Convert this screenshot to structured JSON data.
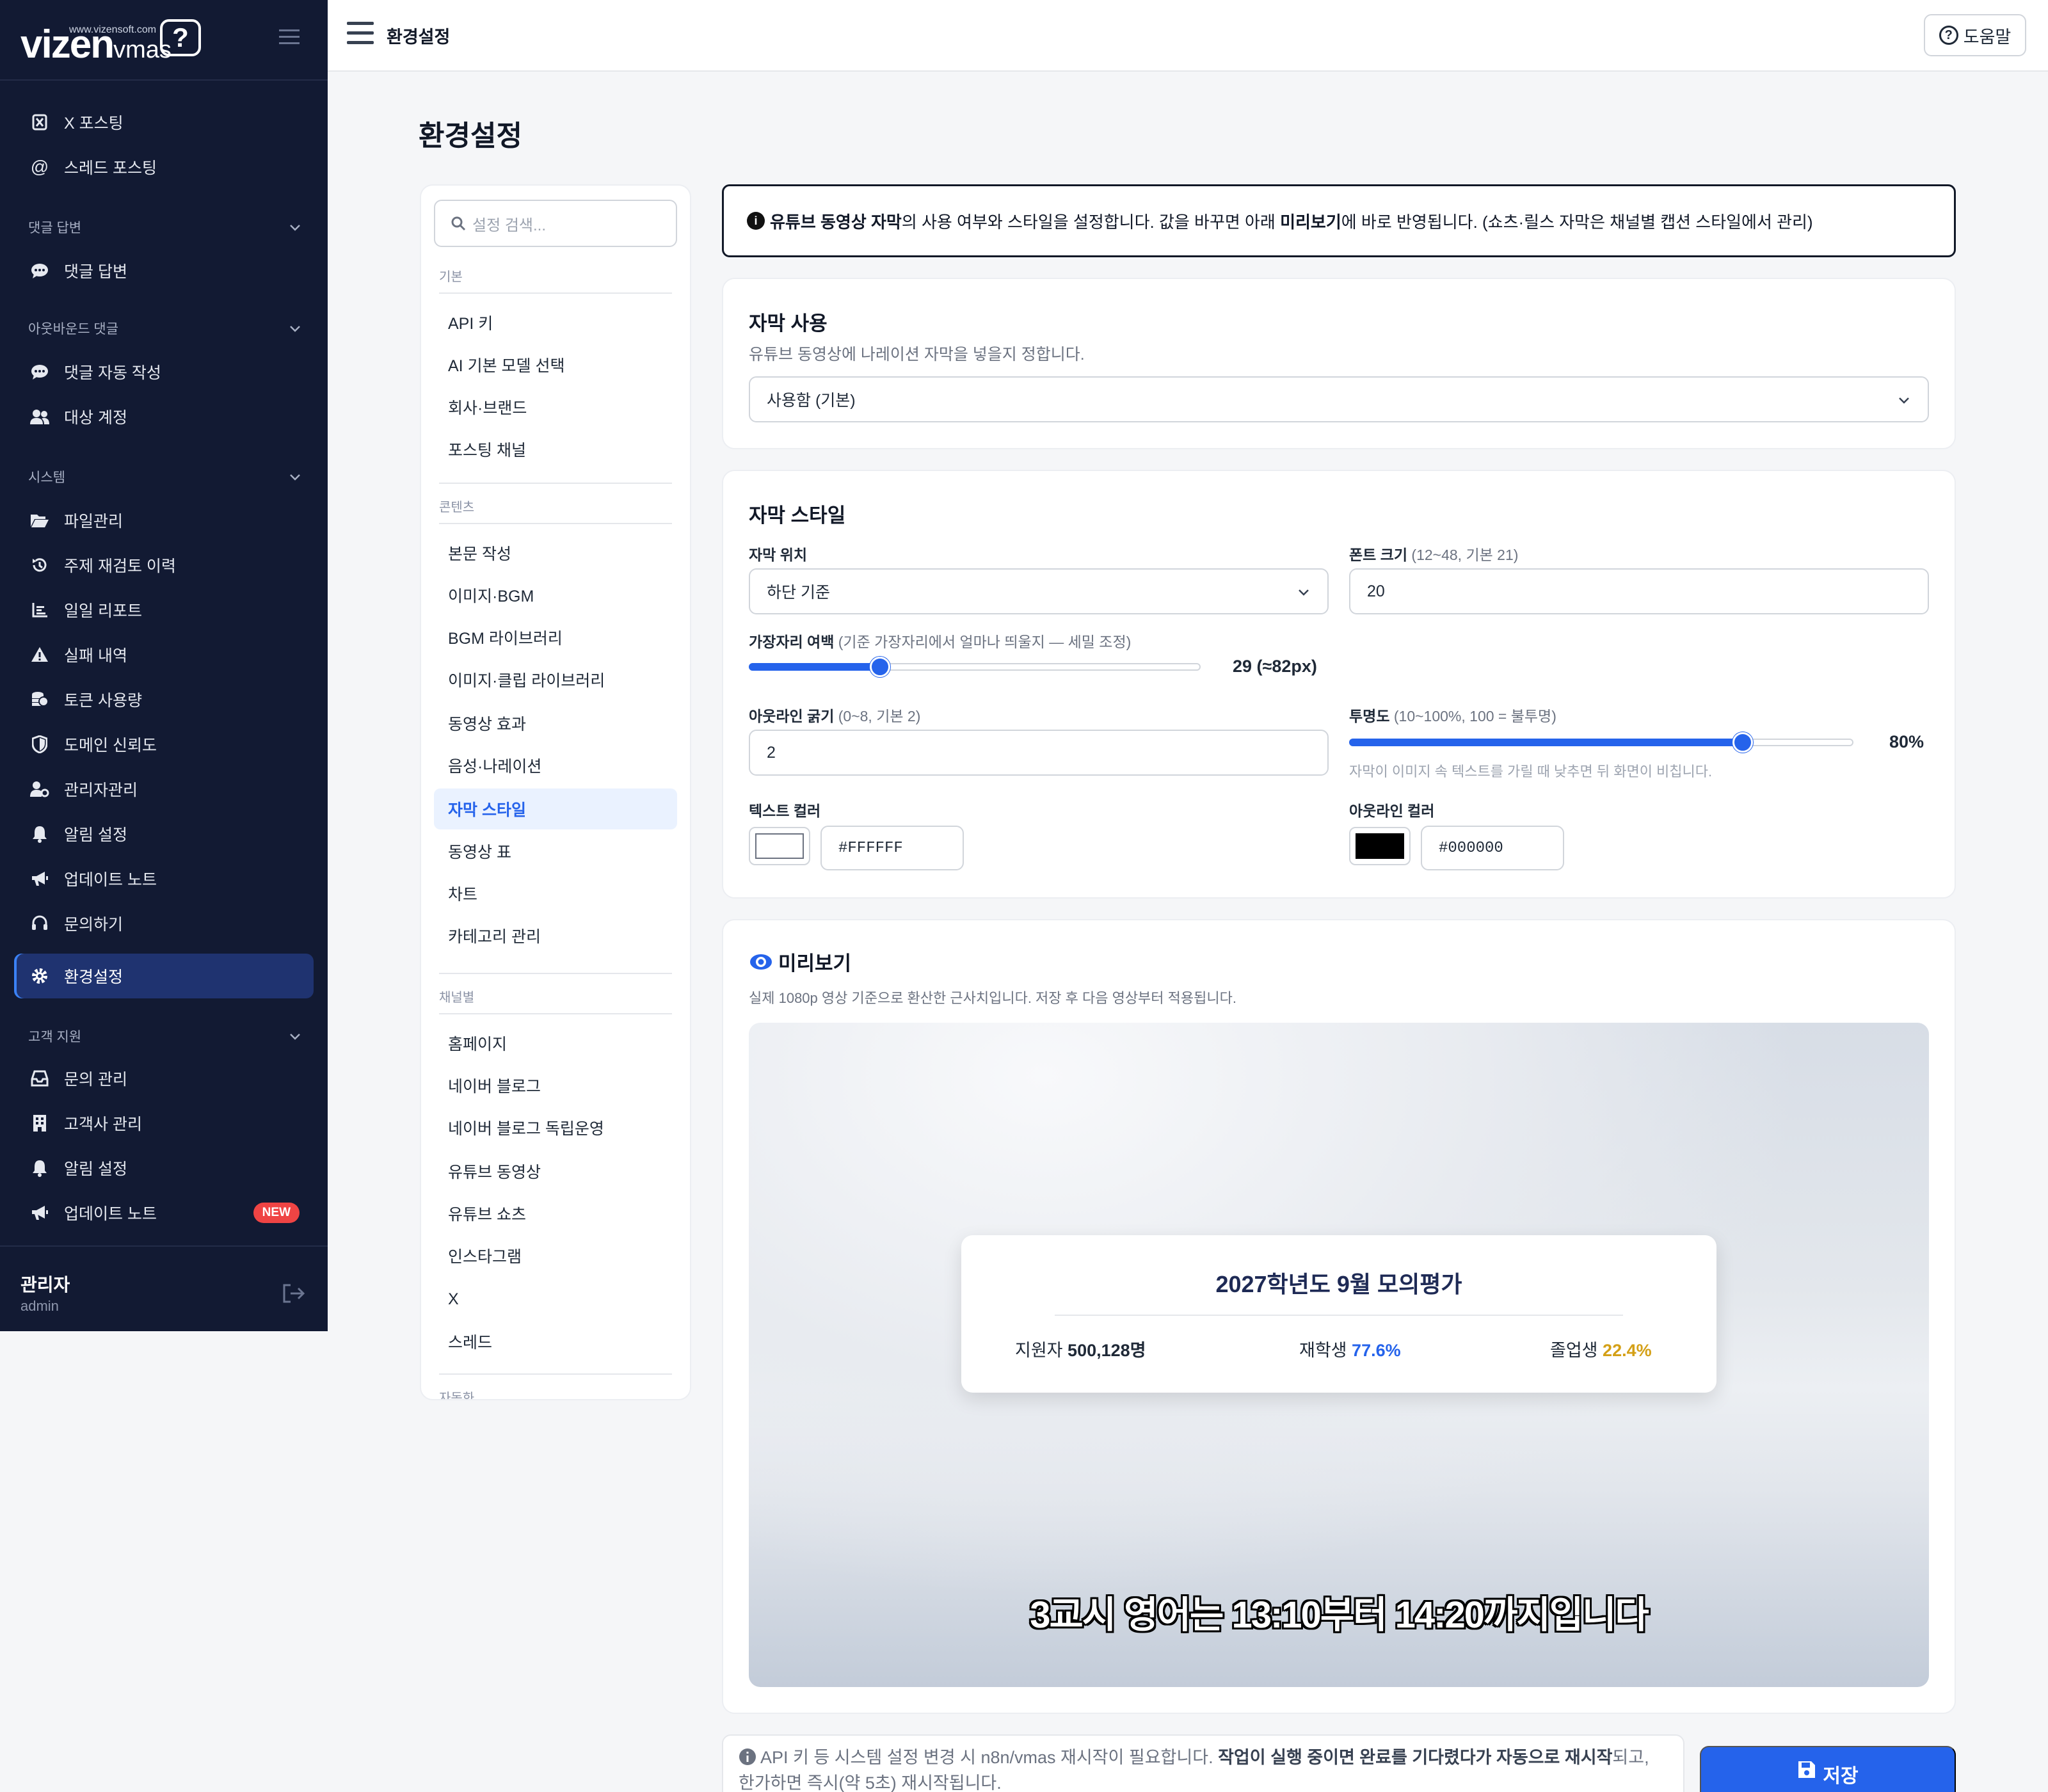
{
  "brand": {
    "logo_main": "vizen",
    "logo_sub": "vmas",
    "url": "www.vizensoft.com",
    "mark": "?"
  },
  "sidebar": {
    "items": [
      {
        "label": "X 포스팅",
        "icon": "x-icon"
      },
      {
        "label": "스레드 포스팅",
        "icon": "at-icon"
      },
      {
        "label": "댓글 답변",
        "icon": "comment-icon"
      },
      {
        "label": "댓글 자동 작성",
        "icon": "comment-icon"
      },
      {
        "label": "대상 계정",
        "icon": "users-icon"
      },
      {
        "label": "파일관리",
        "icon": "folder-icon"
      },
      {
        "label": "주제 재검토 이력",
        "icon": "history-icon"
      },
      {
        "label": "일일 리포트",
        "icon": "chart-icon"
      },
      {
        "label": "실패 내역",
        "icon": "warning-icon"
      },
      {
        "label": "토큰 사용량",
        "icon": "coins-icon"
      },
      {
        "label": "도메인 신뢰도",
        "icon": "shield-icon"
      },
      {
        "label": "관리자관리",
        "icon": "user-gear-icon"
      },
      {
        "label": "알림 설정",
        "icon": "bell-icon"
      },
      {
        "label": "업데이트 노트",
        "icon": "megaphone-icon"
      },
      {
        "label": "문의하기",
        "icon": "headset-icon"
      },
      {
        "label": "환경설정",
        "icon": "gear-icon"
      },
      {
        "label": "문의 관리",
        "icon": "inbox-icon"
      },
      {
        "label": "고객사 관리",
        "icon": "building-icon"
      },
      {
        "label": "알림 설정",
        "icon": "bell-icon"
      },
      {
        "label": "업데이트 노트",
        "icon": "megaphone-icon"
      }
    ],
    "sections": [
      "댓글 답변",
      "아웃바운드 댓글",
      "시스템",
      "고객 지원"
    ],
    "new_badge": "NEW",
    "user_name": "관리자",
    "user_id": "admin"
  },
  "topbar": {
    "title": "환경설정",
    "help_label": "도움말"
  },
  "page_title": "환경설정",
  "settings_nav": {
    "search_placeholder": "설정 검색...",
    "groups": [
      "기본",
      "콘텐츠",
      "채널별",
      "자동화"
    ],
    "basic": [
      "API 키",
      "AI 기본 모델 선택",
      "회사·브랜드",
      "포스팅 채널"
    ],
    "content": [
      "본문 작성",
      "이미지·BGM",
      "BGM 라이브러리",
      "이미지·클립 라이브러리",
      "동영상 효과",
      "음성·나레이션",
      "자막 스타일",
      "동영상 표",
      "차트",
      "카테고리 관리"
    ],
    "channel": [
      "홈페이지",
      "네이버 블로그",
      "네이버 블로그 독립운영",
      "유튜브 동영상",
      "유튜브 쇼츠",
      "인스타그램",
      "X",
      "스레드"
    ]
  },
  "notice": {
    "pre": "",
    "bold1": "유튜브 동영상 자막",
    "mid": "의 사용 여부와 스타일을 설정합니다. 값을 바꾸면 아래 ",
    "bold2": "미리보기",
    "post": "에 바로 반영됩니다. (쇼츠·릴스 자막은 채널별 캡션 스타일에서 관리)"
  },
  "subtitle_use": {
    "title": "자막 사용",
    "desc": "유튜브 동영상에 나레이션 자막을 넣을지 정합니다.",
    "value": "사용함 (기본)"
  },
  "subtitle_style": {
    "title": "자막 스타일",
    "position_label": "자막 위치",
    "position_value": "하단 기준",
    "font_size_label": "폰트 크기",
    "font_size_hint": "(12~48, 기본 21)",
    "font_size_value": "20",
    "margin_label": "가장자리 여백",
    "margin_hint": "(기준 가장자리에서 얼마나 띄울지 — 세밀 조정)",
    "margin_value_text": "29 (≈82px)",
    "margin_fraction": 0.29,
    "outline_label": "아웃라인 굵기",
    "outline_hint": "(0~8, 기본 2)",
    "outline_value": "2",
    "opacity_label": "투명도",
    "opacity_hint": "(10~100%, 100 = 불투명)",
    "opacity_value_text": "80%",
    "opacity_fraction": 0.78,
    "opacity_desc": "자막이 이미지 속 텍스트를 가릴 때 낮추면 뒤 화면이 비칩니다.",
    "text_color_label": "텍스트 컬러",
    "text_color_value": "#FFFFFF",
    "outline_color_label": "아웃라인 컬러",
    "outline_color_value": "#000000"
  },
  "preview": {
    "title": "미리보기",
    "desc": "실제 1080p 영상 기준으로 환산한 근사치입니다. 저장 후 다음 영상부터 적용됩니다.",
    "card_title": "2027학년도 9월 모의평가",
    "stat1_label": "지원자",
    "stat1_value": "500,128명",
    "stat2_label": "재학생",
    "stat2_value": "77.6%",
    "stat3_label": "졸업생",
    "stat3_value": "22.4%",
    "subtitle_text": "3교시 영어는 13:10부터 14:20까지입니다"
  },
  "footer": {
    "note_pre": "API 키 등 시스템 설정 변경 시 n8n/vmas 재시작이 필요합니다. ",
    "note_bold": "작업이 실행 중이면 완료를 기다렸다가 자동으로 재시작",
    "note_post": "되고, 한가하면 즉시(약 5초) 재시작됩니다.",
    "save_label": "저장"
  },
  "colors": {
    "accent": "#2563eb",
    "sidebar_bg": "#121a33",
    "active_bg": "#1f3370",
    "stat2": "#2563eb",
    "stat3": "#d4a017",
    "badge": "#ef4444"
  }
}
